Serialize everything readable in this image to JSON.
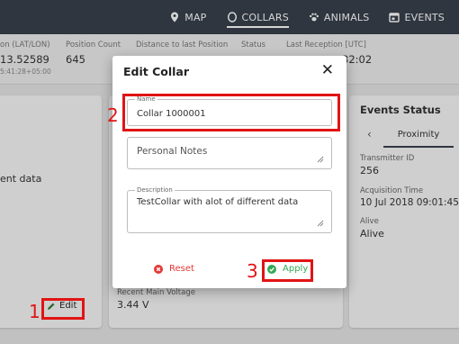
{
  "nav": {
    "items": [
      {
        "label": "MAP",
        "icon": "map-pin-icon"
      },
      {
        "label": "COLLARS",
        "icon": "collar-icon"
      },
      {
        "label": "ANIMALS",
        "icon": "paw-icon"
      },
      {
        "label": "EVENTS",
        "icon": "calendar-icon"
      }
    ],
    "active": "COLLARS"
  },
  "info": {
    "position": {
      "label": "on (LAT/LON)",
      "value": "13.52589",
      "sub": "5:41:28+05:00"
    },
    "count": {
      "label": "Position Count",
      "value": "645"
    },
    "distance": {
      "label": "Distance to last Position",
      "value": ""
    },
    "status": {
      "label": "Status",
      "value": ""
    },
    "reception": {
      "label": "Last Reception [UTC]",
      "value": "32:02"
    }
  },
  "left_card": {
    "text": "ent data",
    "edit_label": "Edit"
  },
  "middle_card": {
    "voltage_label": "Recent Main Voltage",
    "voltage_value": "3.44 V"
  },
  "events": {
    "title": "Events Status",
    "tab_label": "Proximity",
    "fields": [
      {
        "label": "Transmitter ID",
        "value": "256"
      },
      {
        "label": "Acquisition Time",
        "value": "10 Jul 2018 09:01:45"
      },
      {
        "label": "Alive",
        "value": "Alive"
      }
    ]
  },
  "dialog": {
    "title": "Edit Collar",
    "close": "✕",
    "name_label": "Name",
    "name_value": "Collar 1000001",
    "notes_placeholder": "Personal Notes",
    "description_label": "Description",
    "description_value": "TestCollar with alot of different data",
    "reset_label": "Reset",
    "apply_label": "Apply"
  },
  "annotations": [
    "1",
    "2",
    "3"
  ],
  "colors": {
    "nav_bg": "#39414d",
    "highlight": "#e11414",
    "apply": "#34a853",
    "reset": "#e53935"
  }
}
